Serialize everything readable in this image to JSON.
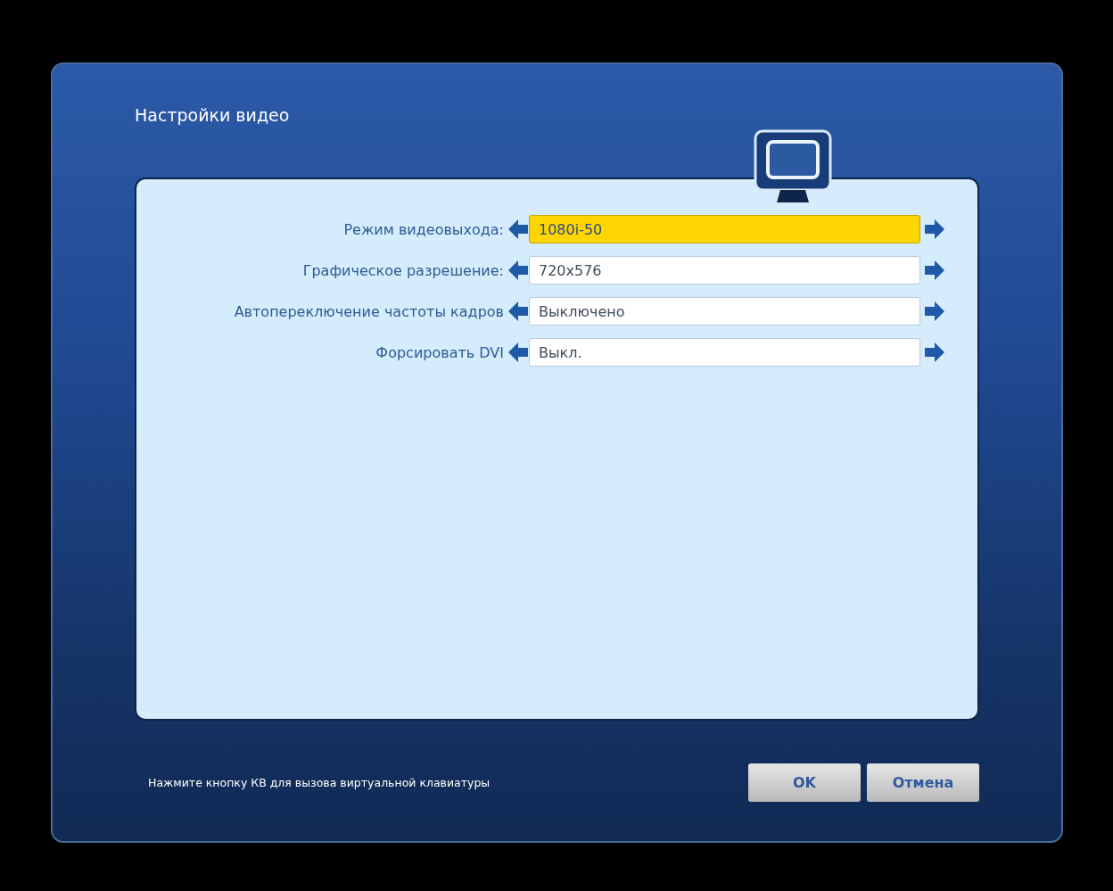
{
  "window": {
    "title": "Настройки видео"
  },
  "settings": [
    {
      "label": "Режим видеовыхода:",
      "value": "1080i-50",
      "selected": true
    },
    {
      "label": "Графическое разрешение:",
      "value": "720x576",
      "selected": false
    },
    {
      "label": "Автопереключение частоты кадров",
      "value": "Выключено",
      "selected": false
    },
    {
      "label": "Форсировать DVI",
      "value": "Выкл.",
      "selected": false
    }
  ],
  "hint": "Нажмите кнопку КВ для вызова виртуальной клавиатуры",
  "buttons": [
    "OK",
    "Отмена"
  ]
}
